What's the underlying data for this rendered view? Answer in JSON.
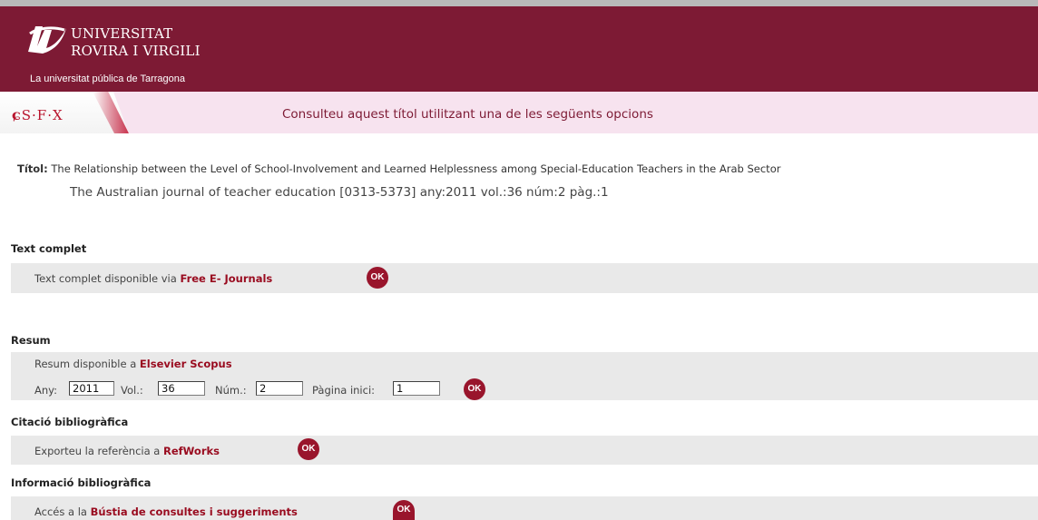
{
  "header": {
    "university_line1": "UNIVERSITAT",
    "university_line2": "ROVIRA I VIRGILI",
    "subtitle": "La universitat pública de Tarragona",
    "sfx_logo": "S·F·X",
    "banner": "Consulteu aquest títol utilitzant una de les següents opcions",
    "colors": {
      "brand": "#7d1a34",
      "accent": "#99152c",
      "banner_bg": "#f7e3ef"
    }
  },
  "record": {
    "title_label": "Títol:",
    "title": "The Relationship between the Level of School-Involvement and Learned Helplessness among Special-Education Teachers in the Arab Sector",
    "citation": "The Australian journal of teacher education [0313-5373] any:2011 vol.:36 núm:2 pàg.:1"
  },
  "sections": {
    "fulltext": {
      "heading": "Text complet",
      "text": "Text complet disponible via",
      "link": "Free E- Journals",
      "ok": "OK"
    },
    "abstract": {
      "heading": "Resum",
      "text": "Resum disponible a",
      "link": "Elsevier Scopus",
      "year_label": "Any:",
      "year_value": "2011",
      "vol_label": "Vol.:",
      "vol_value": "36",
      "num_label": "Núm.:",
      "num_value": "2",
      "page_label": "Pàgina inici:",
      "page_value": "1",
      "ok": "OK"
    },
    "citation": {
      "heading": "Citació bibliogràfica",
      "text": "Exporteu la referència a",
      "link": "RefWorks",
      "ok": "OK"
    },
    "info": {
      "heading": "Informació bibliogràfica",
      "text": "Accés a la",
      "link": "Bústia de consultes i suggeriments",
      "ok": "OK"
    }
  }
}
